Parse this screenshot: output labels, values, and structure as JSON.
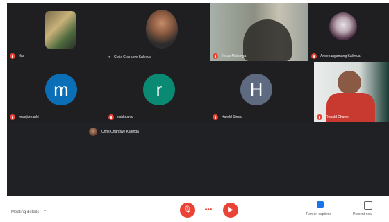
{
  "participants": [
    {
      "name": "Ifas",
      "avatar": "photo"
    },
    {
      "name": "Chris Changwe Kalenda",
      "avatar": "photo"
    },
    {
      "name": "Jesus Mubanga",
      "avatar": "video"
    },
    {
      "name": "Andeeangamang Kalimua",
      "avatar": "photo"
    },
    {
      "name": "mweji.zeanki",
      "letter": "m",
      "color": "#0b6fb7"
    },
    {
      "name": "r.akkdanal",
      "letter": "r",
      "color": "#0b8a73"
    },
    {
      "name": "Harold Sinca",
      "letter": "H",
      "color": "#5d6a80"
    },
    {
      "name": "Ronald Chawe",
      "avatar": "video"
    }
  ],
  "presenter": {
    "name": "Chris Changwe Kalenda"
  },
  "bottom": {
    "meeting_details": "Meeting details",
    "captions": "Turn on captions",
    "present": "Present now",
    "end_icon": "end-call-icon",
    "mic_icon": "mic-off-icon",
    "cam_icon": "cam-off-icon"
  }
}
